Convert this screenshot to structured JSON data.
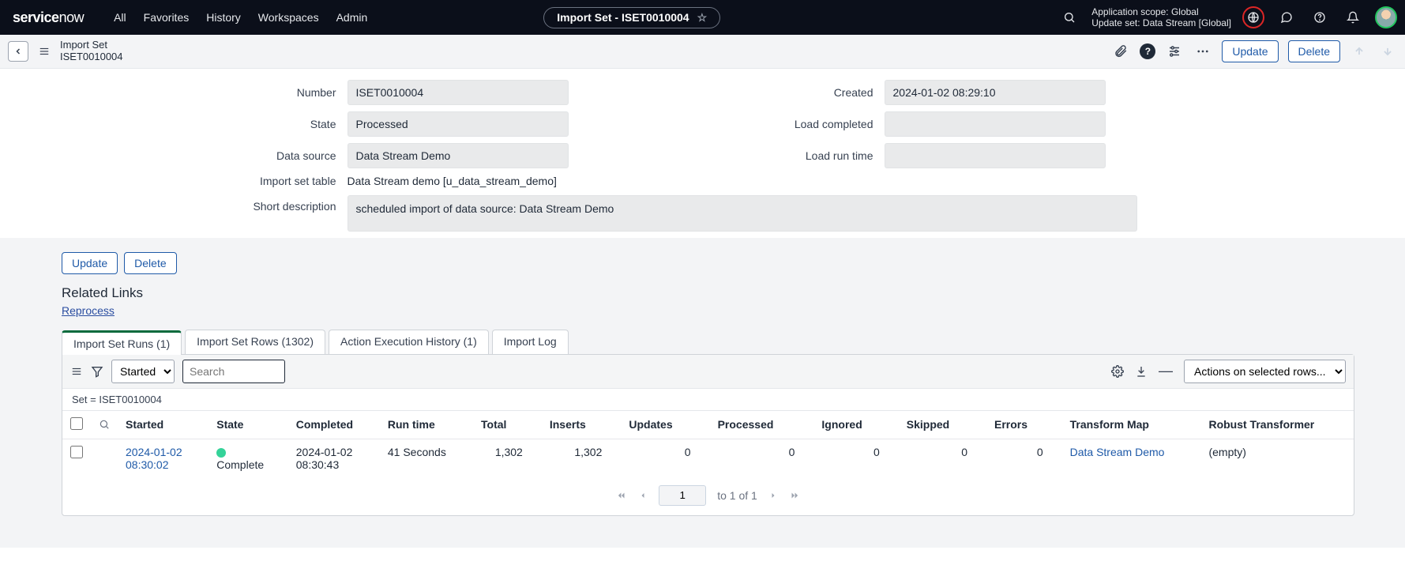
{
  "topnav": {
    "logo_a": "service",
    "logo_b": "now",
    "items": [
      "All",
      "Favorites",
      "History",
      "Workspaces",
      "Admin"
    ],
    "pill_label": "Import Set - ISET0010004",
    "scope_line1": "Application scope: Global",
    "scope_line2": "Update set: Data Stream [Global]"
  },
  "subheader": {
    "title1": "Import Set",
    "title2": "ISET0010004",
    "update": "Update",
    "delete": "Delete"
  },
  "form": {
    "number_label": "Number",
    "number_value": "ISET0010004",
    "state_label": "State",
    "state_value": "Processed",
    "datasource_label": "Data source",
    "datasource_value": "Data Stream Demo",
    "table_label": "Import set table",
    "table_value": "Data Stream demo [u_data_stream_demo]",
    "created_label": "Created",
    "created_value": "2024-01-02 08:29:10",
    "loadcomp_label": "Load completed",
    "loadcomp_value": "",
    "loadrun_label": "Load run time",
    "loadrun_value": "",
    "desc_label": "Short description",
    "desc_value": "scheduled import of data source: Data Stream Demo"
  },
  "lower": {
    "update": "Update",
    "delete": "Delete",
    "section_title": "Related Links",
    "reprocess": "Reprocess"
  },
  "tabs": {
    "t1": "Import Set Runs (1)",
    "t2": "Import Set Rows (1302)",
    "t3": "Action Execution History (1)",
    "t4": "Import Log"
  },
  "toolbar": {
    "field_option": "Started",
    "search_placeholder": "Search",
    "actions_label": "Actions on selected rows..."
  },
  "breadcrumb": "Set = ISET0010004",
  "columns": {
    "started": "Started",
    "state": "State",
    "completed": "Completed",
    "runtime": "Run time",
    "total": "Total",
    "inserts": "Inserts",
    "updates": "Updates",
    "processed": "Processed",
    "ignored": "Ignored",
    "skipped": "Skipped",
    "errors": "Errors",
    "map": "Transform Map",
    "robust": "Robust Transformer"
  },
  "row": {
    "started_a": "2024-01-02",
    "started_b": "08:30:02",
    "state": "Complete",
    "completed_a": "2024-01-02",
    "completed_b": "08:30:43",
    "runtime": "41 Seconds",
    "total": "1,302",
    "inserts": "1,302",
    "updates": "0",
    "processed": "0",
    "ignored": "0",
    "skipped": "0",
    "errors": "0",
    "map": "Data Stream Demo",
    "robust": "(empty)"
  },
  "pager": {
    "page": "1",
    "text": "to 1 of 1"
  }
}
